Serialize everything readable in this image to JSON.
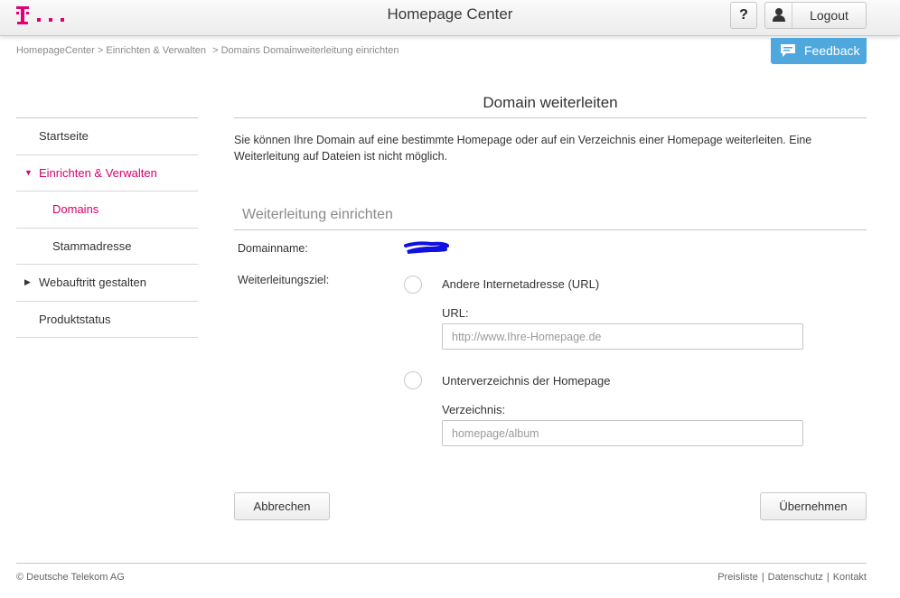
{
  "header": {
    "title": "Homepage Center",
    "help_label": "?",
    "logout_label": "Logout",
    "brand_color": "#e20074"
  },
  "breadcrumb": {
    "items": [
      "HomepageCenter > Einrichten & Verwalten",
      "> Domains Domainweiterleitung einrichten"
    ]
  },
  "feedback": {
    "label": "Feedback",
    "color": "#4fa8dd"
  },
  "sidebar": {
    "items": [
      {
        "label": "Startseite"
      },
      {
        "label": "Einrichten & Verwalten",
        "arrow": "▼"
      },
      {
        "label": "Domains"
      },
      {
        "label": "Stammadresse"
      },
      {
        "label": "Webauftritt gestalten",
        "arrow": "▶"
      },
      {
        "label": "Produktstatus"
      }
    ]
  },
  "main": {
    "title": "Domain weiterleiten",
    "intro": "Sie können Ihre Domain auf eine bestimmte Homepage oder auf ein Verzeichnis einer Homepage weiterleiten.   Eine Weiterleitung auf Dateien ist nicht möglich.",
    "section_title": "Weiterleitung einrichten",
    "domainname_label": "Domainname:",
    "target_label": "Weiterleitungsziel:",
    "option_url_label": "Andere Internetadresse (URL)",
    "url_field_label": "URL:",
    "url_placeholder": "http://www.Ihre-Homepage.de",
    "url_value": "",
    "option_dir_label": "Unterverzeichnis der Homepage",
    "dir_field_label": "Verzeichnis:",
    "dir_placeholder": "homepage/album",
    "dir_value": "",
    "cancel_label": "Abbrechen",
    "apply_label": "Übernehmen"
  },
  "footer": {
    "copyright": "© Deutsche Telekom AG",
    "links": [
      "Preisliste",
      "Datenschutz",
      "Kontakt"
    ],
    "separator": "|"
  }
}
